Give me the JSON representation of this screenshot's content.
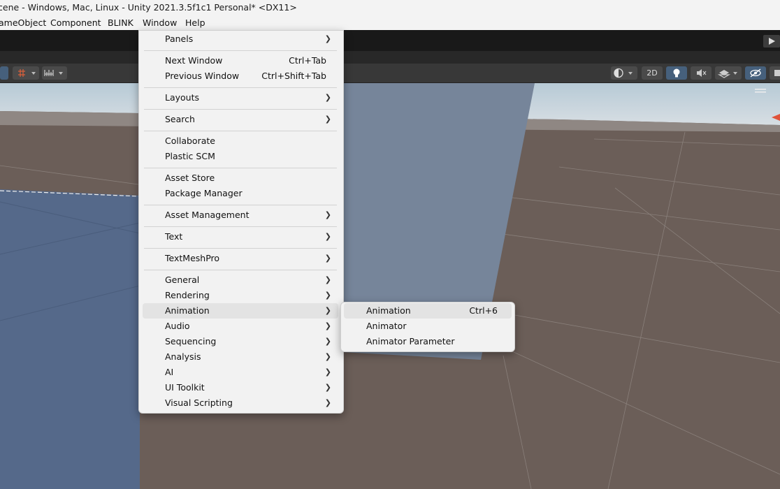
{
  "window": {
    "title": "cene - Windows, Mac, Linux - Unity 2021.3.5f1c1 Personal* <DX11>"
  },
  "menubar": {
    "items": [
      "ameObject",
      "Component",
      "BLINK",
      "Window",
      "Help"
    ]
  },
  "scene_toolbar": {
    "btn_2d": "2D"
  },
  "window_menu": {
    "panels": "Panels",
    "next_window": "Next Window",
    "next_window_sc": "Ctrl+Tab",
    "previous_window": "Previous Window",
    "previous_window_sc": "Ctrl+Shift+Tab",
    "layouts": "Layouts",
    "search": "Search",
    "collaborate": "Collaborate",
    "plastic_scm": "Plastic SCM",
    "asset_store": "Asset Store",
    "package_manager": "Package Manager",
    "asset_management": "Asset Management",
    "text": "Text",
    "textmeshpro": "TextMeshPro",
    "general": "General",
    "rendering": "Rendering",
    "animation": "Animation",
    "audio": "Audio",
    "sequencing": "Sequencing",
    "analysis": "Analysis",
    "ai": "AI",
    "ui_toolkit": "UI Toolkit",
    "visual_scripting": "Visual Scripting"
  },
  "animation_submenu": {
    "animation": "Animation",
    "animation_sc": "Ctrl+6",
    "animator": "Animator",
    "animator_parameter": "Animator Parameter"
  },
  "colors": {
    "menu_bg": "#f2f2f2",
    "menu_hover": "#e3e3e3",
    "scene_ground": "#6b5e58",
    "scene_sky": "#c9d6df",
    "plane_blue": "#5a6f8c"
  }
}
